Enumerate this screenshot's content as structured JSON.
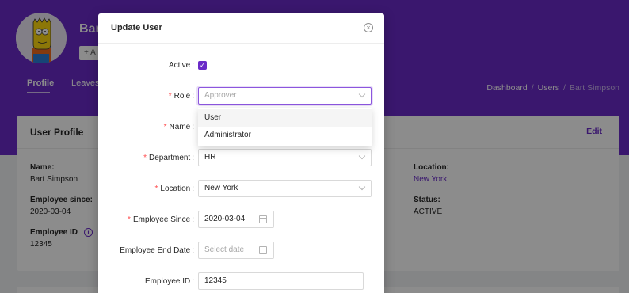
{
  "header": {
    "user_name": "Bart",
    "add_label": "+ A",
    "tabs": [
      {
        "label": "Profile",
        "active": true
      },
      {
        "label": "Leaves",
        "active": false
      }
    ],
    "breadcrumb": [
      "Dashboard",
      "Users",
      "Bart Simpson"
    ]
  },
  "profile_card": {
    "title": "User Profile",
    "edit_label": "Edit",
    "fields": {
      "name": {
        "label": "Name:",
        "value": "Bart Simpson"
      },
      "employee_since": {
        "label": "Employee since:",
        "value": "2020-03-04"
      },
      "employee_id": {
        "label": "Employee ID",
        "value": "12345",
        "icon": "info-icon"
      },
      "location": {
        "label": "Location:",
        "value": "New York"
      },
      "status": {
        "label": "Status:",
        "value": "ACTIVE"
      }
    }
  },
  "modal": {
    "title": "Update User",
    "close_icon": "close-circle-icon",
    "rows": {
      "active": {
        "label": "Active",
        "required": false,
        "checked": true
      },
      "role": {
        "label": "Role",
        "required": true,
        "placeholder": "Approver"
      },
      "name": {
        "label": "Name",
        "required": true
      },
      "department": {
        "label": "Department",
        "required": true,
        "value": "HR"
      },
      "location": {
        "label": "Location",
        "required": true,
        "value": "New York"
      },
      "employee_since": {
        "label": "Employee Since",
        "required": true,
        "value": "2020-03-04"
      },
      "employee_end_date": {
        "label": "Employee End Date",
        "required": false,
        "placeholder": "Select date"
      },
      "employee_id": {
        "label": "Employee ID",
        "required": false,
        "value": "12345"
      }
    },
    "role_options": [
      "User",
      "Administrator"
    ],
    "required_marker": "*",
    "colon": ":"
  },
  "colors": {
    "brand": "#6a2bc8",
    "required": "#ff4d4f"
  }
}
